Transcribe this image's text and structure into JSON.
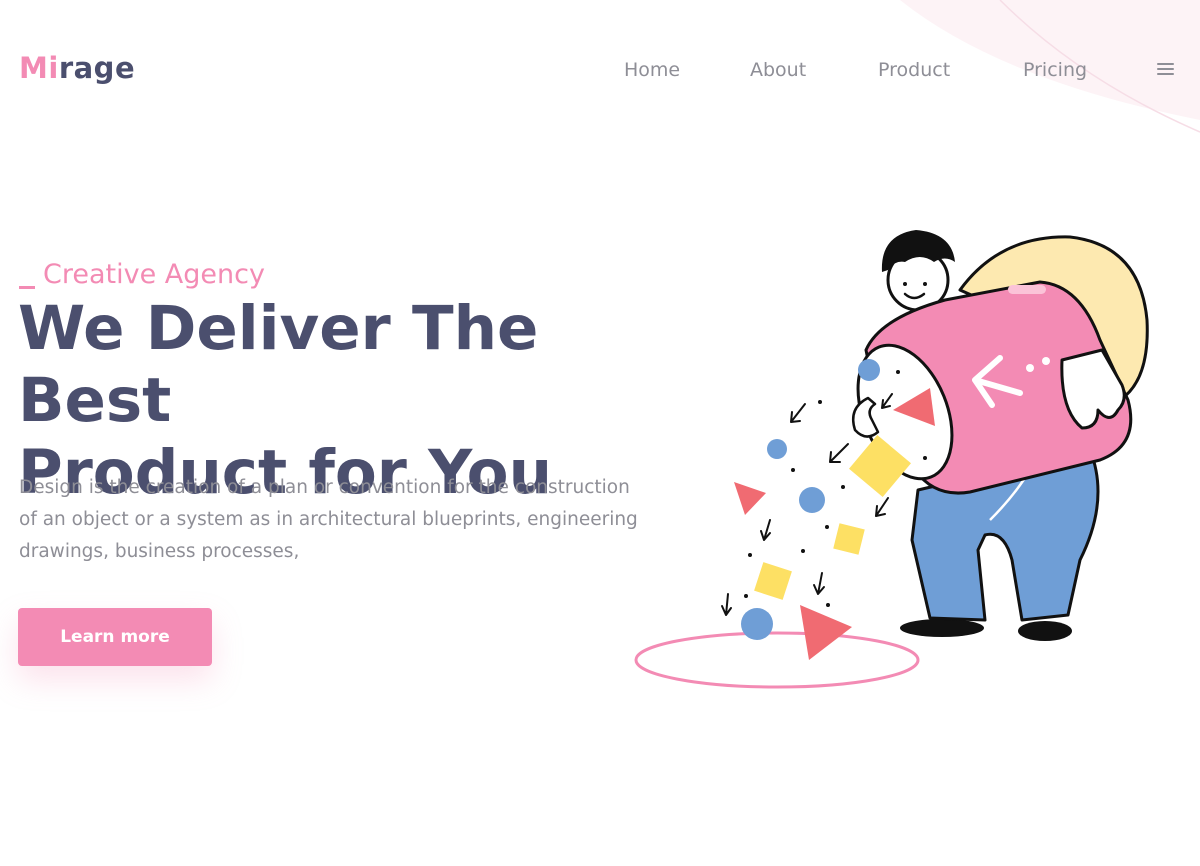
{
  "brand": {
    "name_accent": "Mi",
    "name_rest": "rage"
  },
  "nav": {
    "items": [
      {
        "label": "Home"
      },
      {
        "label": "About"
      },
      {
        "label": "Product"
      },
      {
        "label": "Pricing"
      }
    ],
    "menu_icon": "hamburger-menu-icon"
  },
  "hero": {
    "eyebrow": "Creative Agency",
    "title_line1": "We Deliver The Best",
    "title_line2": "Product for You",
    "description": "Design is the creation of a plan or convention for the construction of an object or a system as in architectural blueprints, engineering drawings, business processes,",
    "cta_label": "Learn more"
  },
  "colors": {
    "accent_pink": "#f38bb4",
    "heading": "#4b4f6e",
    "body_text": "#8e8e96",
    "shape_blue": "#6f9ed6",
    "shape_yellow": "#fde064",
    "shape_red": "#f06b72",
    "bag_cream": "#fde9b0"
  },
  "illustration": {
    "subject": "person-pouring-shapes-from-tube-illustration"
  }
}
